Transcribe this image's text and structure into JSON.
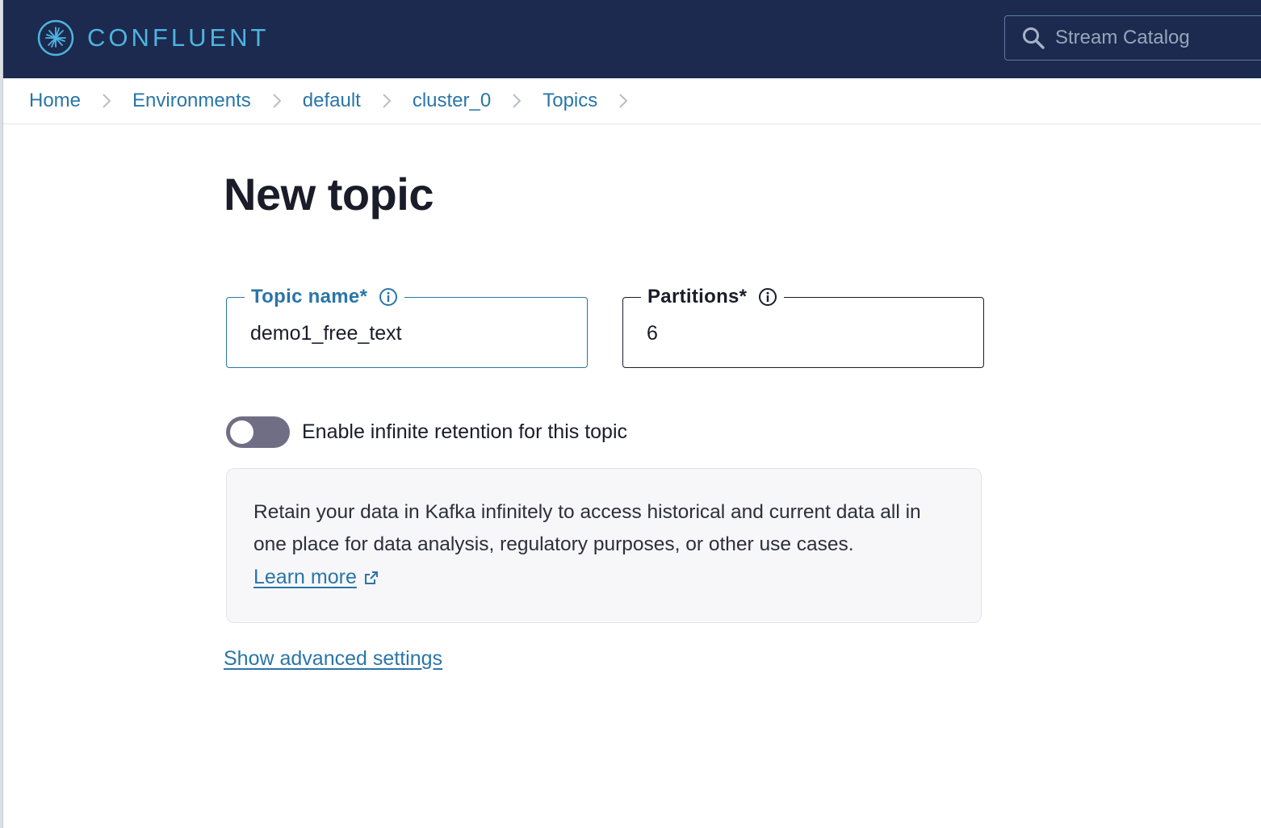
{
  "header": {
    "brand_name": "CONFLUENT",
    "search": {
      "placeholder": "Stream Catalog",
      "value": ""
    }
  },
  "breadcrumb": {
    "items": [
      "Home",
      "Environments",
      "default",
      "cluster_0",
      "Topics"
    ]
  },
  "page": {
    "title": "New topic"
  },
  "form": {
    "topic_name": {
      "label": "Topic name*",
      "value": "demo1_free_text"
    },
    "partitions": {
      "label": "Partitions*",
      "value": "6"
    },
    "infinite_retention": {
      "label": "Enable infinite retention for this topic",
      "enabled": false
    },
    "info_box": {
      "text": "Retain your data in Kafka infinitely to access historical and current data all in one place for data analysis, regulatory purposes, or other use cases.",
      "link_label": "Learn more"
    },
    "advanced_link": "Show advanced settings"
  },
  "colors": {
    "header_bg": "#1b2a4e",
    "brand": "#4fb3e0",
    "link": "#2a75a8",
    "toggle_off": "#6f6e85"
  }
}
